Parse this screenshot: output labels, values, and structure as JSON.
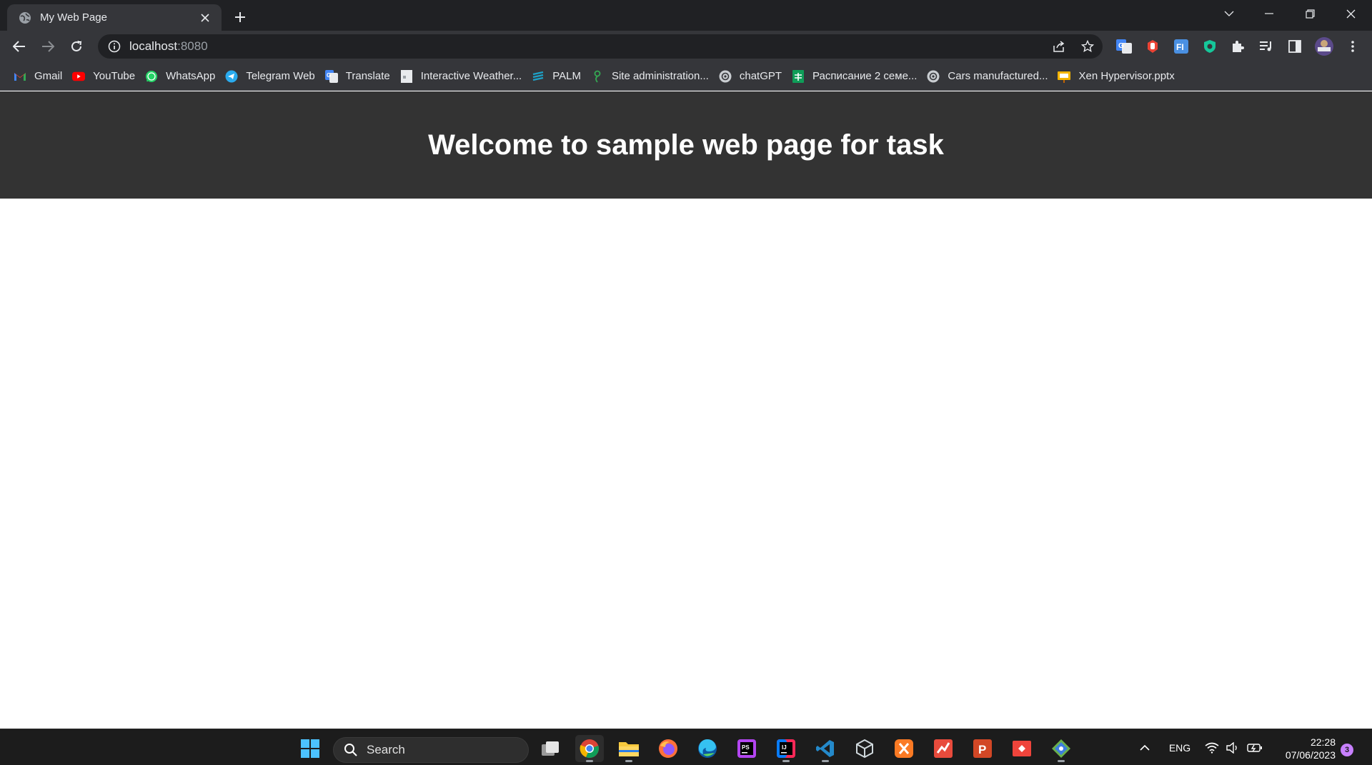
{
  "browser": {
    "tab": {
      "title": "My Web Page"
    },
    "address_bar": {
      "host": "localhost",
      "port": ":8080"
    },
    "bookmarks": [
      {
        "label": "Gmail",
        "icon": "gmail-icon",
        "color": "#ea4335"
      },
      {
        "label": "YouTube",
        "icon": "youtube-icon",
        "color": "#ff0000"
      },
      {
        "label": "WhatsApp",
        "icon": "whatsapp-icon",
        "color": "#25d366"
      },
      {
        "label": "Telegram Web",
        "icon": "telegram-icon",
        "color": "#2aabee"
      },
      {
        "label": "Translate",
        "icon": "translate-icon",
        "color": "#4285f4"
      },
      {
        "label": "Interactive Weather...",
        "icon": "page-icon",
        "color": "#e8eaed"
      },
      {
        "label": "PALM",
        "icon": "palm-icon",
        "color": "#1da1c7"
      },
      {
        "label": "Site administration...",
        "icon": "moodle-icon",
        "color": "#34a853"
      },
      {
        "label": "chatGPT",
        "icon": "openai-icon",
        "color": "#c9cdd1"
      },
      {
        "label": "Расписание 2 семе...",
        "icon": "sheets-icon",
        "color": "#0f9d58"
      },
      {
        "label": "Cars manufactured...",
        "icon": "openai-icon",
        "color": "#c9cdd1"
      },
      {
        "label": "Xen Hypervisor.pptx",
        "icon": "slides-icon",
        "color": "#f4b400"
      }
    ]
  },
  "page": {
    "heading": "Welcome to sample web page for task",
    "header_bg": "#333333"
  },
  "taskbar": {
    "search_label": "Search",
    "language": "ENG",
    "time": "22:28",
    "date": "07/06/2023",
    "notification_count": "3"
  }
}
